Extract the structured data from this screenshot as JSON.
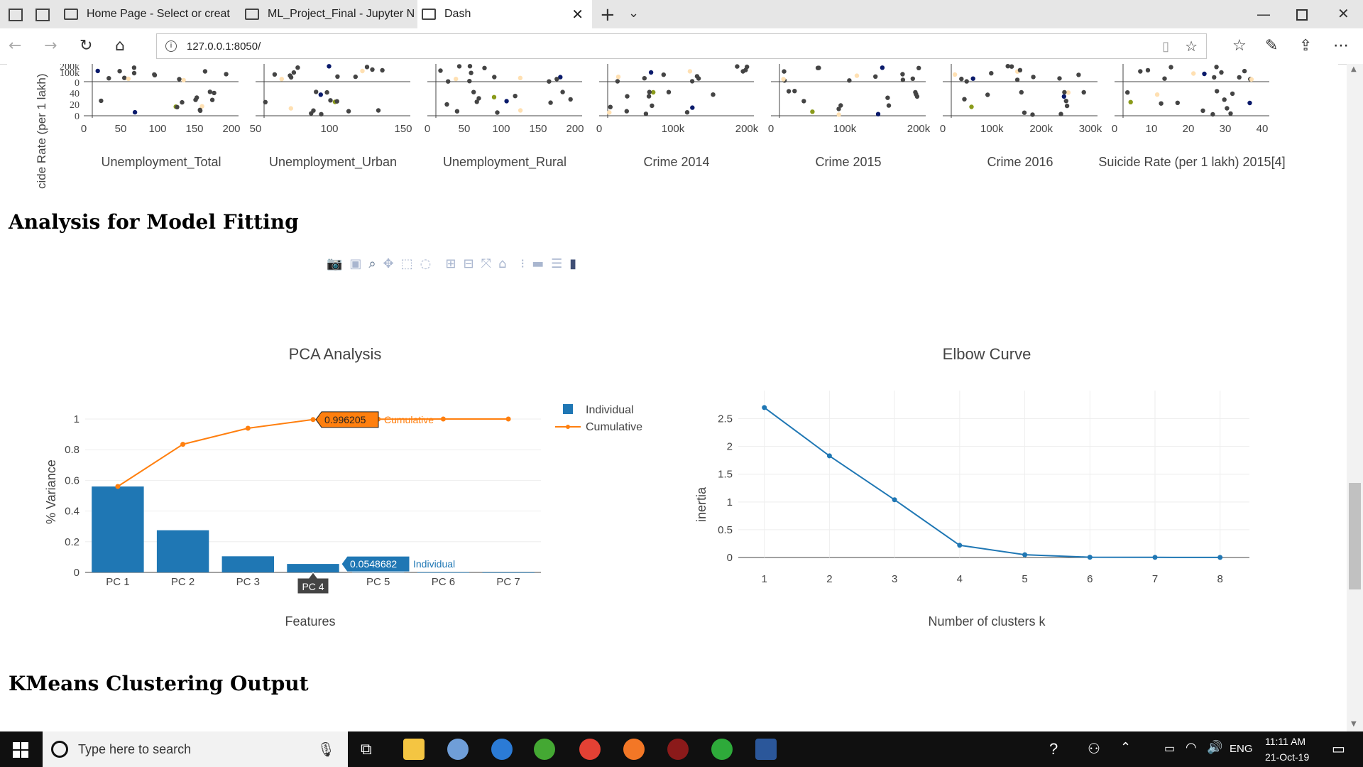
{
  "browser": {
    "tabs": [
      {
        "title": "Home Page - Select or creat"
      },
      {
        "title": "ML_Project_Final - Jupyter N"
      },
      {
        "title": "Dash"
      }
    ],
    "url": "127.0.0.1:8050/"
  },
  "page": {
    "section1_title": "Analysis for Model Fitting",
    "section2_title": "KMeans Clustering Output",
    "scatter_matrix": {
      "y_title": "cide Rate (per 1 lakh)",
      "y_ticks_upper": [
        "200k",
        "100k",
        "0"
      ],
      "y_ticks_lower": [
        "40",
        "20",
        "0"
      ],
      "columns": [
        {
          "title": "Unemployment_Total",
          "ticks": [
            "0",
            "50",
            "100",
            "150",
            "200"
          ]
        },
        {
          "title": "Unemployment_Urban",
          "ticks": [
            "50",
            "100",
            "150"
          ]
        },
        {
          "title": "Unemployment_Rural",
          "ticks": [
            "0",
            "50",
            "100",
            "150",
            "200"
          ]
        },
        {
          "title": "Crime 2014",
          "ticks": [
            "0",
            "100k",
            "200k"
          ]
        },
        {
          "title": "Crime 2015",
          "ticks": [
            "0",
            "100k",
            "200k"
          ]
        },
        {
          "title": "Crime 2016",
          "ticks": [
            "0",
            "100k",
            "200k",
            "300k"
          ]
        },
        {
          "title": "Suicide Rate (per 1 lakh) 2015[4]",
          "ticks": [
            "0",
            "10",
            "20",
            "30",
            "40"
          ]
        }
      ]
    }
  },
  "colors": {
    "bar": "#1f77b4",
    "cumulative": "#ff7f0e",
    "elbow": "#1f77b4"
  },
  "chart_data": [
    {
      "type": "bar",
      "title": "PCA Analysis",
      "xlabel": "Features",
      "ylabel": "% Variance",
      "categories": [
        "PC 1",
        "PC 2",
        "PC 3",
        "PC 4",
        "PC 5",
        "PC 6",
        "PC 7"
      ],
      "series": [
        {
          "name": "Individual",
          "type": "bar",
          "values": [
            0.56,
            0.275,
            0.105,
            0.0548682,
            0.003,
            0.001,
            0.0005
          ]
        },
        {
          "name": "Cumulative",
          "type": "line",
          "values": [
            0.56,
            0.835,
            0.94,
            0.996205,
            0.999,
            1.0,
            1.0
          ]
        }
      ],
      "ylim": [
        0,
        1
      ],
      "y_ticks": [
        "0",
        "0.2",
        "0.4",
        "0.6",
        "0.8",
        "1"
      ],
      "hover_labels": {
        "individual": "0.0548682",
        "cumulative": "0.996205",
        "x": "PC 4"
      },
      "legend": "top-right"
    },
    {
      "type": "line",
      "title": "Elbow Curve",
      "xlabel": "Number of clusters k",
      "ylabel": "inertia",
      "x": [
        1,
        2,
        3,
        4,
        5,
        6,
        7,
        8
      ],
      "y": [
        2.7,
        1.83,
        1.04,
        0.22,
        0.05,
        0.005,
        0.002,
        0.001
      ],
      "ylim": [
        0,
        2.7
      ],
      "y_ticks": [
        "0",
        "0.5",
        "1",
        "1.5",
        "2",
        "2.5"
      ],
      "x_ticks": [
        "1",
        "2",
        "3",
        "4",
        "5",
        "6",
        "7",
        "8"
      ]
    }
  ],
  "taskbar": {
    "search_placeholder": "Type here to search",
    "lang": "ENG",
    "time": "11:11 AM",
    "date": "21-Oct-19"
  }
}
